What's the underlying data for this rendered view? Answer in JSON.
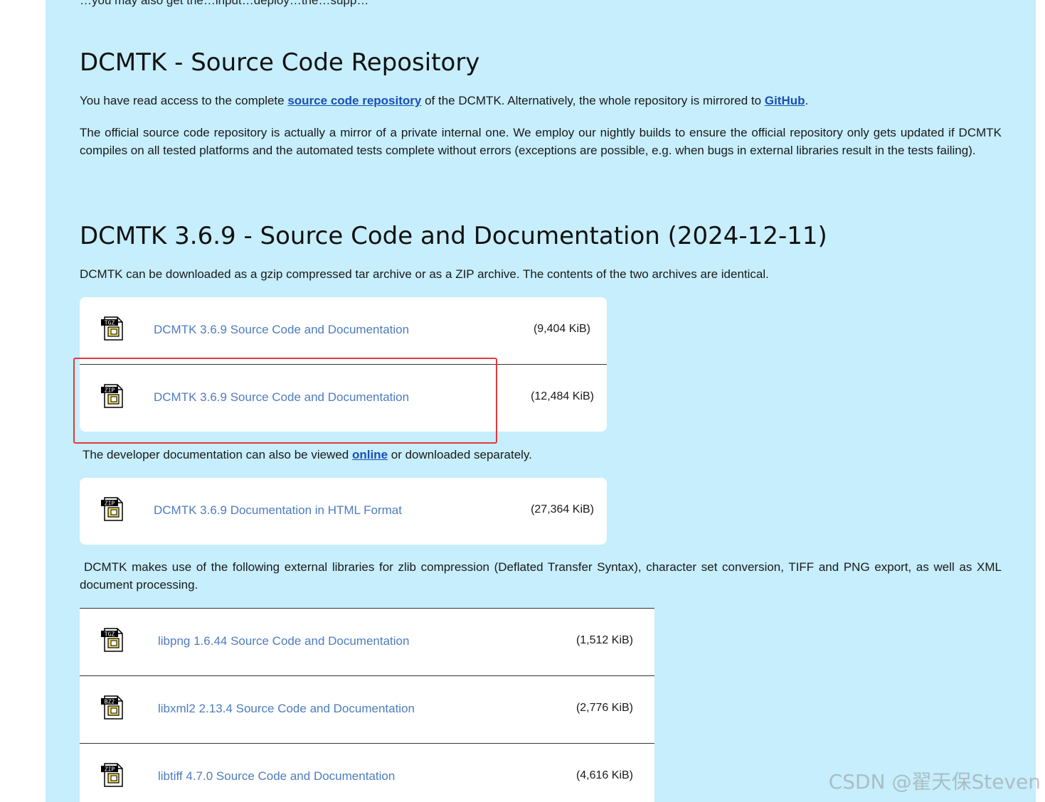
{
  "top_cut_text": "…you may also get the…input…deploy…the…supp…",
  "repo_section": {
    "heading": "DCMTK - Source Code Repository",
    "p1_before": "You have read access to the complete ",
    "p1_link": "source code repository",
    "p1_middle": " of the DCMTK. Alternatively, the whole repository is mirrored to ",
    "p1_link2": "GitHub",
    "p1_after": ".",
    "p2": "The official source code repository is actually a mirror of a private internal one. We employ our nightly builds to ensure the official repository only gets updated if DCMTK compiles on all tested platforms and the automated tests complete without errors (exceptions are possible, e.g. when bugs in external libraries result in the tests failing)."
  },
  "source_section": {
    "heading": "DCMTK 3.6.9 - Source Code and Documentation (2024-12-11)",
    "intro": "DCMTK can be downloaded as a gzip compressed tar archive or as a ZIP archive. The contents of the two archives are identical.",
    "downloads": [
      {
        "icon": "tgz-file-icon",
        "icon_text": "TGZ",
        "label": "DCMTK 3.6.9 Source Code and Documentation",
        "size": "(9,404 KiB)"
      },
      {
        "icon": "zip-file-icon",
        "icon_text": "ZIP",
        "label": "DCMTK 3.6.9 Source Code and Documentation",
        "size": "(12,484 KiB)"
      }
    ],
    "doc_before": "The developer documentation can also be viewed ",
    "doc_link": "online",
    "doc_after": " or downloaded separately.",
    "doc_download": {
      "icon": "zip-file-icon",
      "icon_text": "ZIP",
      "label": "DCMTK 3.6.9 Documentation in HTML Format",
      "size": "(27,364 KiB)"
    },
    "libs_intro": "DCMTK makes use of the following external libraries for zlib compression (Deflated Transfer Syntax), character set conversion, TIFF and PNG export, as well as XML document processing.",
    "libs": [
      {
        "icon": "tgz-file-icon",
        "icon_text": "TGZ",
        "label": "libpng 1.6.44 Source Code and Documentation",
        "size": "(1,512 KiB)"
      },
      {
        "icon": "bz2-file-icon",
        "icon_text": "BZ2",
        "label": "libxml2 2.13.4 Source Code and Documentation",
        "size": "(2,776 KiB)"
      },
      {
        "icon": "zip-file-icon",
        "icon_text": "ZIP",
        "label": "libtiff 4.7.0 Source Code and Documentation",
        "size": "(4,616 KiB)"
      }
    ]
  },
  "colors": {
    "page_bg": "#c6eefc",
    "link": "#4d7cbf",
    "inline_link": "#1a4fb5",
    "highlight": "#e0393c"
  },
  "watermark": "CSDN @翟天保Steven"
}
